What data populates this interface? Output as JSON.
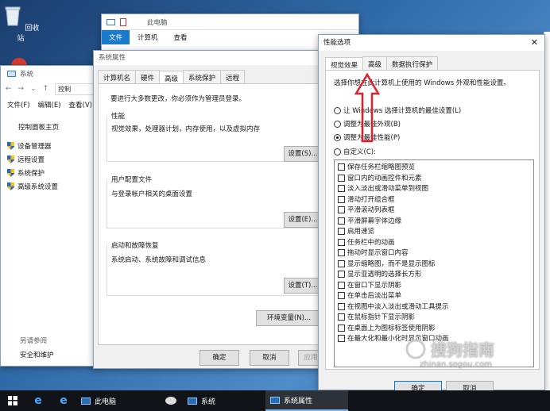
{
  "desktop": {
    "recycle_bin": "回收站"
  },
  "explorer": {
    "ribbon_tabs": [
      "文件",
      "计算机",
      "查看"
    ],
    "title": "此电脑"
  },
  "system_window": {
    "title": "系统",
    "address": "控制",
    "menu": [
      "文件(F)",
      "编辑(E)",
      "查看(V)"
    ],
    "home_link": "控制面板主页",
    "links": [
      "设备管理器",
      "远程设置",
      "系统保护",
      "高级系统设置"
    ],
    "see_also": "另请参阅",
    "security": "安全和维护"
  },
  "sysprops": {
    "title": "系统属性",
    "tabs": [
      "计算机名",
      "硬件",
      "高级",
      "系统保护",
      "远程"
    ],
    "admin_note": "要进行大多数更改，你必须作为管理员登录。",
    "performance": {
      "label": "性能",
      "desc": "视觉效果，处理器计划，内存使用，以及虚拟内存",
      "button": "设置(S)..."
    },
    "profiles": {
      "label": "用户配置文件",
      "desc": "与登录帐户相关的桌面设置",
      "button": "设置(E)..."
    },
    "startup": {
      "label": "启动和故障恢复",
      "desc": "系统启动、系统故障和调试信息",
      "button": "设置(T)..."
    },
    "env_button": "环境变量(N)...",
    "ok": "确定",
    "cancel": "取消",
    "apply": "应用"
  },
  "perf_options": {
    "title": "性能选项",
    "tabs": [
      "视觉效果",
      "高级",
      "数据执行保护"
    ],
    "intro": "选择你想在此计算机上使用的 Windows 外观和性能设置。",
    "radios": [
      "让 Windows 选择计算机的最佳设置(L)",
      "调整为最佳外观(B)",
      "调整为最佳性能(P)",
      "自定义(C):"
    ],
    "selected_radio_index": 2,
    "checkboxes": [
      "保存任务栏缩略图预览",
      "窗口内的动画控件和元素",
      "淡入淡出或滑动菜单到视图",
      "滑动打开组合框",
      "平滑滚动列表框",
      "平滑屏幕字体边缘",
      "启用速览",
      "任务栏中的动画",
      "拖动时显示窗口内容",
      "显示缩略图，而不是显示图标",
      "显示亚透明的选择长方形",
      "在窗口下显示阴影",
      "在单击后淡出菜单",
      "在视图中淡入淡出或滑动工具提示",
      "在鼠标指针下显示阴影",
      "在桌面上为图标标签使用阴影",
      "在最大化和最小化时显示窗口动画"
    ],
    "ok": "确定",
    "cancel": "取消"
  },
  "taskbar": {
    "items": [
      "此电脑",
      "系统",
      "系统属性"
    ]
  },
  "watermark": {
    "text": "搜狗指南",
    "url": "zhinan.sogou.com"
  },
  "colors": {
    "accent": "#0078d7",
    "arrow": "#e0202a"
  }
}
